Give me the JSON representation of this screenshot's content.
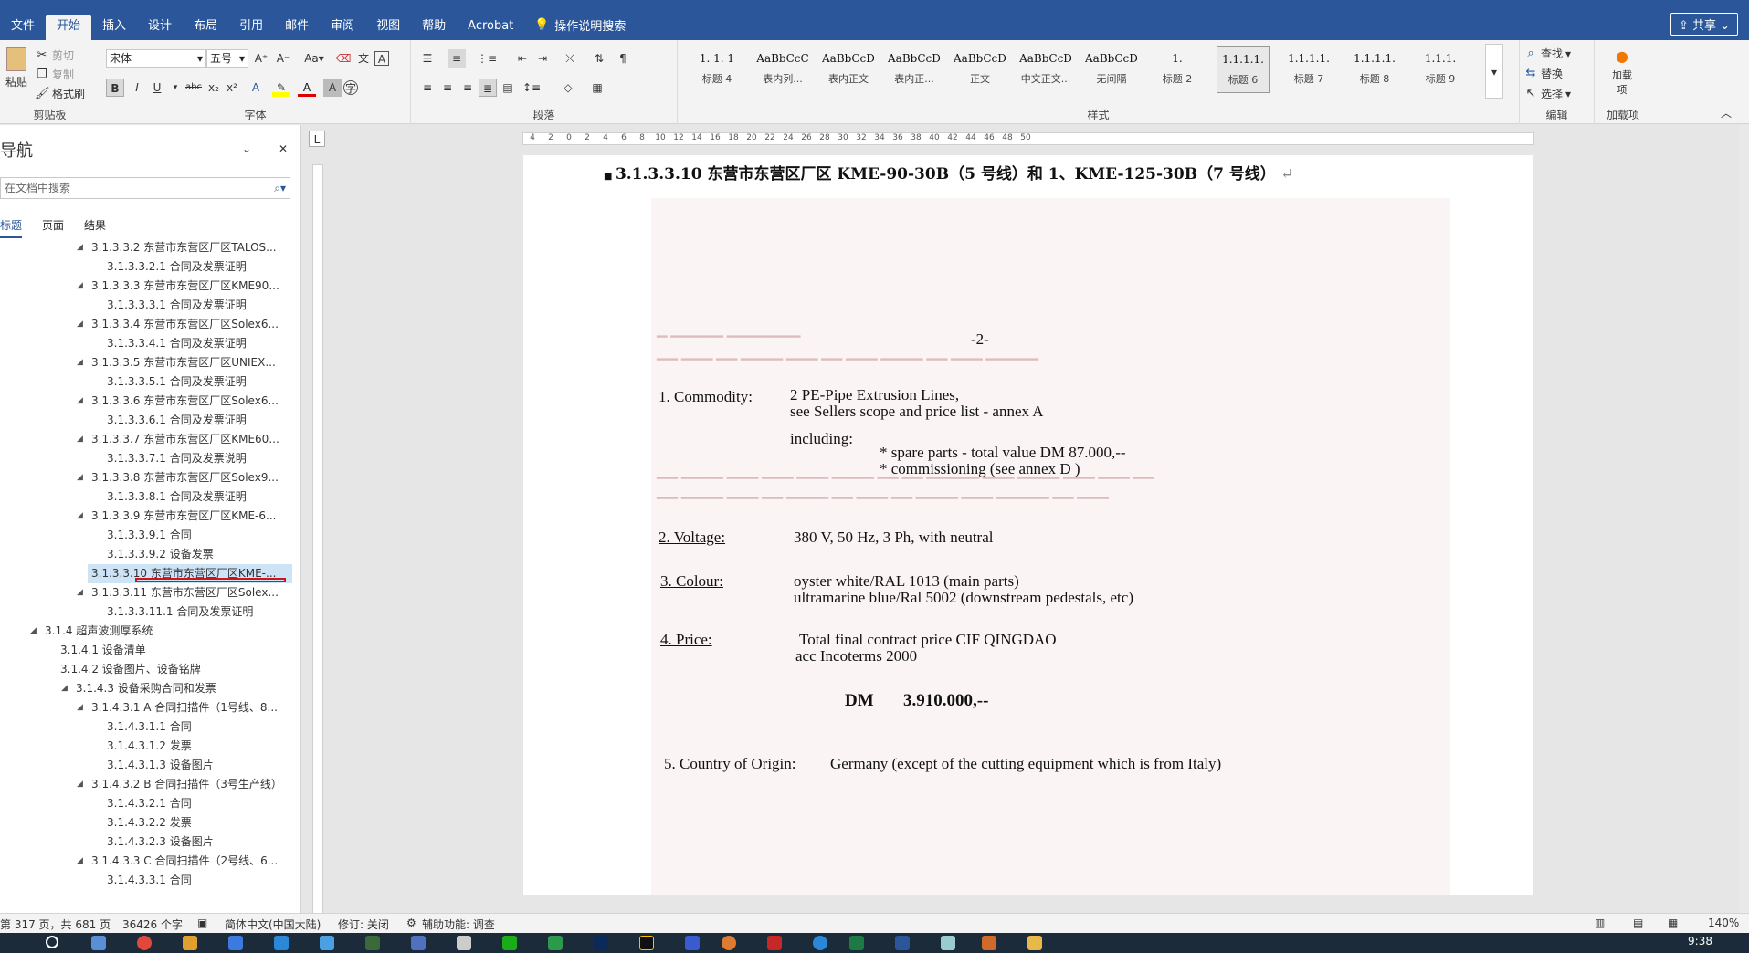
{
  "ribbon_tabs": [
    "文件",
    "开始",
    "插入",
    "设计",
    "布局",
    "引用",
    "邮件",
    "审阅",
    "视图",
    "帮助",
    "Acrobat"
  ],
  "tell_me": "操作说明搜索",
  "share": "共享",
  "clipboard": {
    "paste": "粘贴",
    "cut": "剪切",
    "copy": "复制",
    "format_painter": "格式刷",
    "label": "剪贴板"
  },
  "font": {
    "name": "宋体",
    "size": "五号",
    "label": "字体"
  },
  "paragraph": {
    "label": "段落"
  },
  "styles": {
    "label": "样式",
    "items": [
      {
        "preview": "1. 1. 1",
        "name": "标题 4"
      },
      {
        "preview": "AaBbCcC",
        "name": "表内列..."
      },
      {
        "preview": "AaBbCcDdI",
        "name": "表内正文"
      },
      {
        "preview": "AaBbCcDdI",
        "name": "表内正..."
      },
      {
        "preview": "AaBbCcDdI",
        "name": "正文"
      },
      {
        "preview": "AaBbCcD",
        "name": "中文正文..."
      },
      {
        "preview": "AaBbCcDdI",
        "name": "无间隔"
      },
      {
        "preview": "1.",
        "name": "标题 2"
      },
      {
        "preview": "1.1.1.1.",
        "name": "标题 6"
      },
      {
        "preview": "1.1.1.1.",
        "name": "标题 7"
      },
      {
        "preview": "1.1.1.1.",
        "name": "标题 8"
      },
      {
        "preview": "1.1.1.",
        "name": "标题 9"
      }
    ]
  },
  "editing": {
    "find": "查找",
    "replace": "替换",
    "select": "选择",
    "label": "编辑"
  },
  "addins": {
    "add": "加载项",
    "label": "加载项"
  },
  "nav": {
    "title": "导航",
    "search_placeholder": "在文档中搜索",
    "tabs": [
      "标题",
      "页面",
      "结果"
    ],
    "items": [
      {
        "text": "3.1.3.3.2 东营市东营区厂区TALOS...",
        "level": 0,
        "exp": true
      },
      {
        "text": "3.1.3.3.2.1 合同及发票证明",
        "level": 1,
        "exp": false
      },
      {
        "text": "3.1.3.3.3 东营市东营区厂区KME90...",
        "level": 0,
        "exp": true
      },
      {
        "text": "3.1.3.3.3.1 合同及发票证明",
        "level": 1,
        "exp": false
      },
      {
        "text": "3.1.3.3.4 东营市东营区厂区Solex6...",
        "level": 0,
        "exp": true
      },
      {
        "text": "3.1.3.3.4.1 合同及发票证明",
        "level": 1,
        "exp": false
      },
      {
        "text": "3.1.3.3.5 东营市东营区厂区UNIEX...",
        "level": 0,
        "exp": true
      },
      {
        "text": "3.1.3.3.5.1 合同及发票证明",
        "level": 1,
        "exp": false
      },
      {
        "text": "3.1.3.3.6 东营市东营区厂区Solex6...",
        "level": 0,
        "exp": true
      },
      {
        "text": "3.1.3.3.6.1 合同及发票证明",
        "level": 1,
        "exp": false
      },
      {
        "text": "3.1.3.3.7 东营市东营区厂区KME60...",
        "level": 0,
        "exp": true
      },
      {
        "text": "3.1.3.3.7.1 合同及发票说明",
        "level": 1,
        "exp": false
      },
      {
        "text": "3.1.3.3.8 东营市东营区厂区Solex9...",
        "level": 0,
        "exp": true
      },
      {
        "text": "3.1.3.3.8.1 合同及发票证明",
        "level": 1,
        "exp": false
      },
      {
        "text": "3.1.3.3.9 东营市东营区厂区KME-6...",
        "level": 0,
        "exp": true
      },
      {
        "text": "3.1.3.3.9.1 合同",
        "level": 1,
        "exp": false
      },
      {
        "text": "3.1.3.3.9.2 设备发票",
        "level": 1,
        "exp": false
      },
      {
        "text": "3.1.3.3.10 东营市东营区厂区KME-...",
        "level": 0,
        "exp": false,
        "hl": true
      },
      {
        "text": "3.1.3.3.11 东营市东营区厂区Solex...",
        "level": 0,
        "exp": true
      },
      {
        "text": "3.1.3.3.11.1 合同及发票证明",
        "level": 1,
        "exp": false
      },
      {
        "text": "3.1.4 超声波测厚系统",
        "level": -3,
        "exp": true
      },
      {
        "text": "3.1.4.1 设备清单",
        "level": -2,
        "exp": false
      },
      {
        "text": "3.1.4.2 设备图片、设备铭牌",
        "level": -2,
        "exp": false
      },
      {
        "text": "3.1.4.3 设备采购合同和发票",
        "level": -1,
        "exp": true
      },
      {
        "text": "3.1.4.3.1 A 合同扫描件（1号线、8...",
        "level": 0,
        "exp": true
      },
      {
        "text": "3.1.4.3.1.1 合同",
        "level": 1,
        "exp": false
      },
      {
        "text": "3.1.4.3.1.2 发票",
        "level": 1,
        "exp": false
      },
      {
        "text": "3.1.4.3.1.3 设备图片",
        "level": 1,
        "exp": false
      },
      {
        "text": "3.1.4.3.2 B 合同扫描件（3号生产线）",
        "level": 0,
        "exp": true
      },
      {
        "text": "3.1.4.3.2.1 合同",
        "level": 1,
        "exp": false
      },
      {
        "text": "3.1.4.3.2.2 发票",
        "level": 1,
        "exp": false
      },
      {
        "text": "3.1.4.3.2.3 设备图片",
        "level": 1,
        "exp": false
      },
      {
        "text": "3.1.4.3.3 C 合同扫描件（2号线、6...",
        "level": 0,
        "exp": true
      },
      {
        "text": "3.1.4.3.3.1 合同",
        "level": 1,
        "exp": false
      }
    ]
  },
  "document": {
    "heading": "3.1.3.3.10  东营市东营区厂区 KME-90-30B（5 号线）和 1、KME-125-30B（7 号线）",
    "scan": {
      "page_no": "-2-",
      "commodity_label": "1. Commodity:",
      "commodity_line1": "2  PE-Pipe Extrusion Lines,",
      "commodity_line2": "see Sellers scope and price list - annex  A",
      "including": "including:",
      "spare": "* spare parts  -  total value  DM 87.000,--",
      "commissioning": "* commissioning (see annex D )",
      "voltage_label": "2. Voltage:",
      "voltage": "380 V,  50 Hz,  3 Ph,  with neutral",
      "colour_label": "3. Colour:",
      "colour1": "oyster white/RAL 1013 (main parts)",
      "colour2": "ultramarine blue/Ral 5002 (downstream pedestals, etc)",
      "price_label": "4. Price:",
      "price1": "Total final contract price CIF  QINGDAO",
      "price2": "acc Incoterms 2000",
      "amount_cur": "DM",
      "amount": "3.910.000,--",
      "origin_label": "5. Country of Origin:",
      "origin": "Germany (except of the cutting equipment which is from  Italy)"
    }
  },
  "status": {
    "page": "第 317 页，共 681 页",
    "words": "36426 个字",
    "lang": "简体中文(中国大陆)",
    "track": "修订: 关闭",
    "access": "辅助功能: 调查",
    "zoom": "140%"
  },
  "taskbar": {
    "time": "9:38"
  }
}
